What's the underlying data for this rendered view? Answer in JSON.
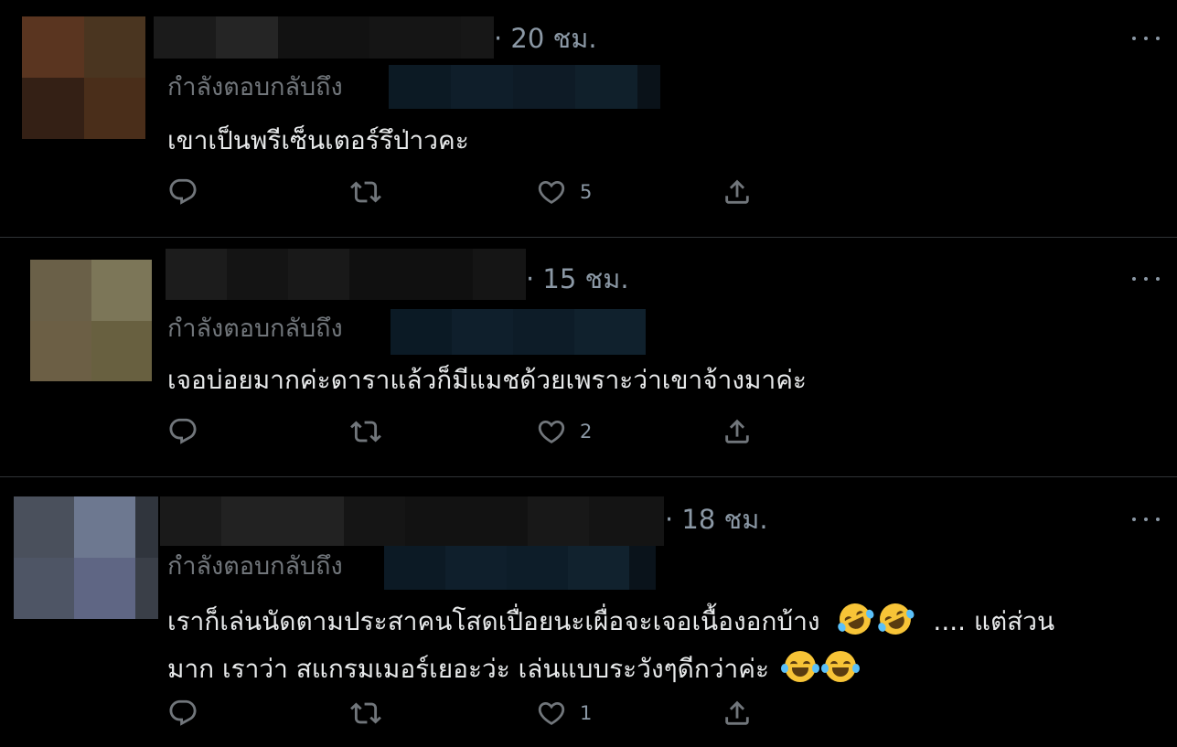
{
  "colors": {
    "background": "#000000",
    "divider": "#2f3336",
    "text_primary": "#e7e9ea",
    "text_secondary": "#71767b"
  },
  "tweets": [
    {
      "time": "· 20 ชม.",
      "reply_label": "กำลังตอบกลับถึง",
      "text_lines": [
        "เขาเป็นพรีเซ็นเตอร์รึป่าวคะ"
      ],
      "likes": "5",
      "avatar_colors": [
        "#5a3520",
        "#4a3520",
        "#342015",
        "#4a2e1a"
      ],
      "name_blur_colors": [
        "#1b1b1b",
        "#252525",
        "#121212",
        "#151515",
        "#171717"
      ],
      "handle_blur_colors": [
        "#0c1a24",
        "#0f1e2a",
        "#0e1b26",
        "#10202b",
        "#0a1219"
      ],
      "icons": [
        "reply-icon",
        "retweet-icon",
        "like-icon",
        "share-icon",
        "more-icon"
      ]
    },
    {
      "time": "· 15 ชม.",
      "reply_label": "กำลังตอบกลับถึง",
      "text_lines": [
        "เจอบ่อยมากค่ะดาราแล้วก็มีแมชด้วยเพราะว่าเขาจ้างมาค่ะ"
      ],
      "likes": "2",
      "avatar_colors": [
        "#6a6048",
        "#7c7658",
        "#6c5f45",
        "#686040"
      ],
      "name_blur_colors": [
        "#1c1c1c",
        "#141414",
        "#191919",
        "#101010",
        "#151515"
      ],
      "handle_blur_colors": [
        "#0b1a25",
        "#0f1f2c",
        "#0d1c28",
        "#10212d"
      ],
      "icons": [
        "reply-icon",
        "retweet-icon",
        "like-icon",
        "share-icon",
        "more-icon"
      ]
    },
    {
      "time": "· 18 ชม.",
      "reply_label": "กำลังตอบกลับถึง",
      "text_lines": [
        "เราก็เล่นนัดตามประสาคนโสดเปื่อยนะเผื่อจะเจอเนื้องอกบ้าง",
        ".... แต่ส่วน",
        "มาก เราว่า สแกรมเมอร์เยอะว่ะ  เล่นแบบระวังๆดีกว่าค่ะ"
      ],
      "likes": "1",
      "avatar_colors": [
        "#4a505c",
        "#6d7890",
        "#30353d",
        "#4e5565",
        "#5f6684",
        "#3a3f48"
      ],
      "name_blur_colors": [
        "#1a1a1a",
        "#222222",
        "#151515",
        "#121212",
        "#181818",
        "#141414"
      ],
      "handle_blur_colors": [
        "#0c1a25",
        "#0f1f2c",
        "#0d1d29",
        "#11222e",
        "#0a131b"
      ],
      "icons": [
        "reply-icon",
        "retweet-icon",
        "like-icon",
        "share-icon",
        "more-icon",
        "rofl-emoji",
        "joy-emoji"
      ]
    }
  ]
}
